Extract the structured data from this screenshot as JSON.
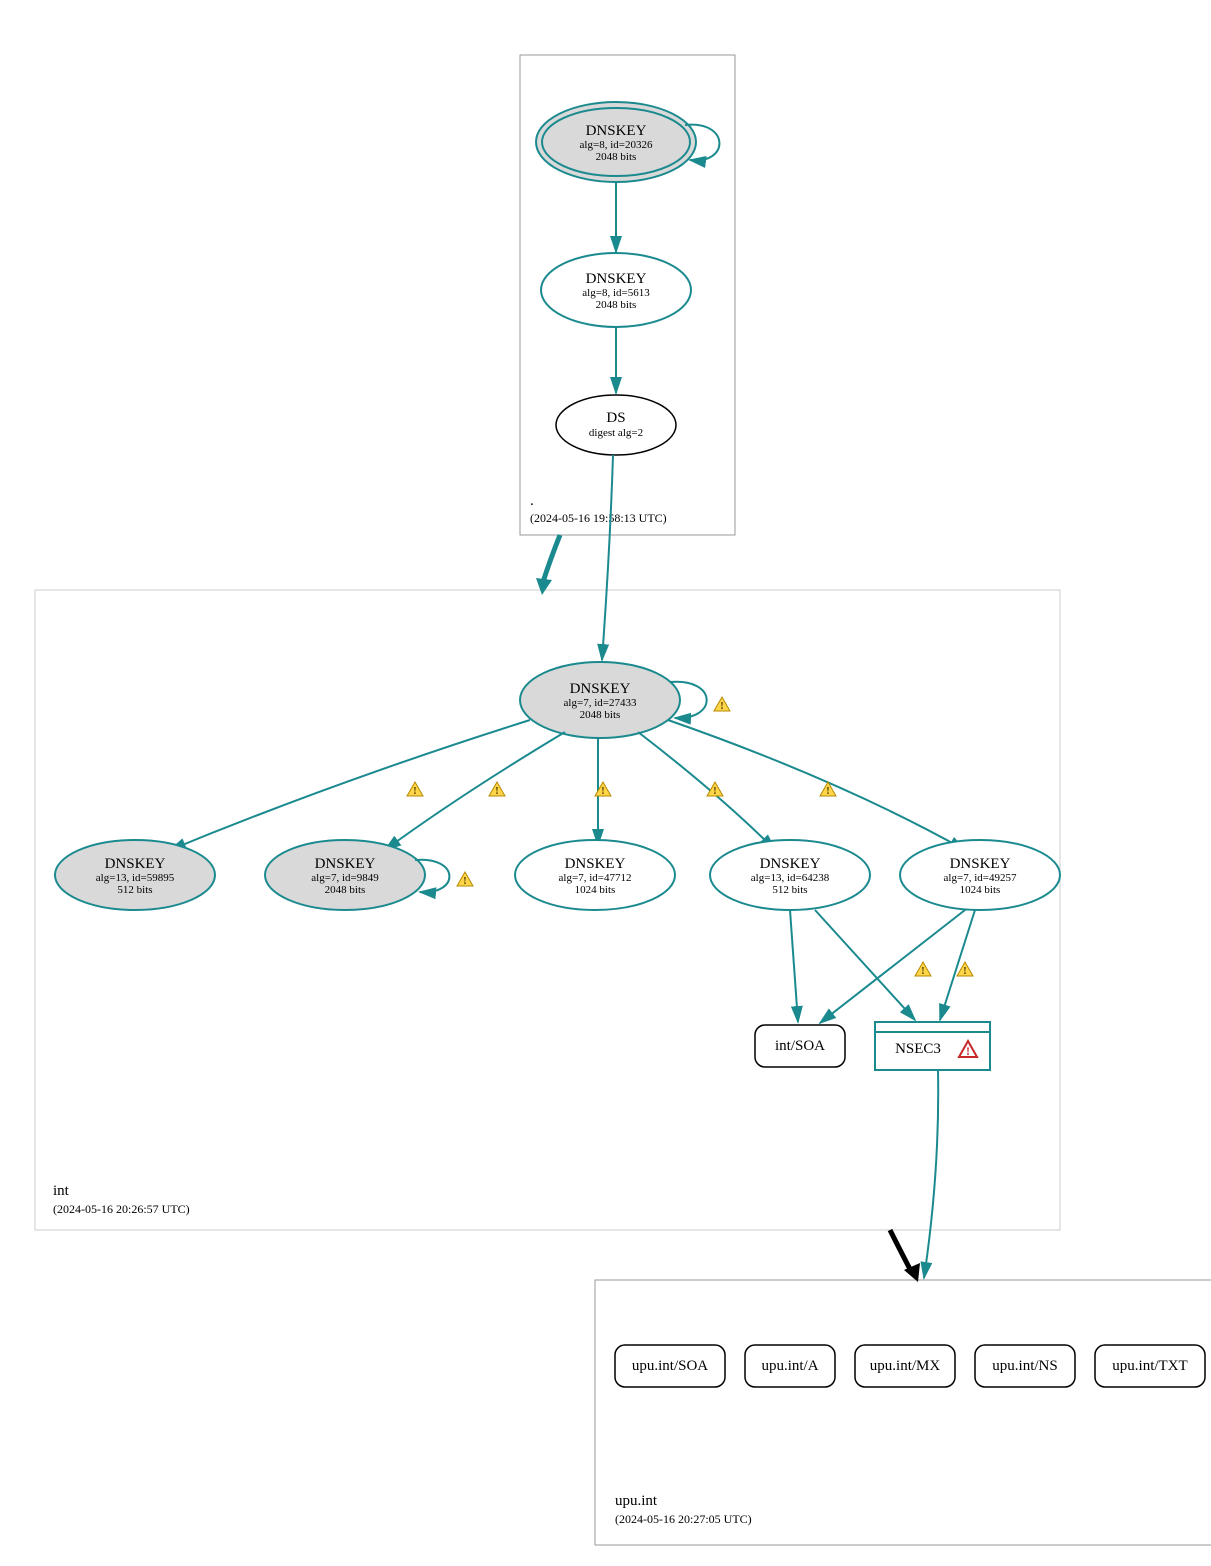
{
  "zones": {
    "root": {
      "label": ".",
      "timestamp": "(2024-05-16 19:58:13 UTC)"
    },
    "int": {
      "label": "int",
      "timestamp": "(2024-05-16 20:26:57 UTC)"
    },
    "upu": {
      "label": "upu.int",
      "timestamp": "(2024-05-16 20:27:05 UTC)"
    }
  },
  "nodes": {
    "root_ksk": {
      "title": "DNSKEY",
      "line2": "alg=8, id=20326",
      "line3": "2048 bits"
    },
    "root_zsk": {
      "title": "DNSKEY",
      "line2": "alg=8, id=5613",
      "line3": "2048 bits"
    },
    "root_ds": {
      "title": "DS",
      "line2": "digest alg=2"
    },
    "int_ksk": {
      "title": "DNSKEY",
      "line2": "alg=7, id=27433",
      "line3": "2048 bits"
    },
    "int_k1": {
      "title": "DNSKEY",
      "line2": "alg=13, id=59895",
      "line3": "512 bits"
    },
    "int_k2": {
      "title": "DNSKEY",
      "line2": "alg=7, id=9849",
      "line3": "2048 bits"
    },
    "int_k3": {
      "title": "DNSKEY",
      "line2": "alg=7, id=47712",
      "line3": "1024 bits"
    },
    "int_k4": {
      "title": "DNSKEY",
      "line2": "alg=13, id=64238",
      "line3": "512 bits"
    },
    "int_k5": {
      "title": "DNSKEY",
      "line2": "alg=7, id=49257",
      "line3": "1024 bits"
    },
    "int_soa": {
      "title": "int/SOA"
    },
    "int_nsec3": {
      "title": "NSEC3"
    },
    "upu_soa": {
      "title": "upu.int/SOA"
    },
    "upu_a": {
      "title": "upu.int/A"
    },
    "upu_mx": {
      "title": "upu.int/MX"
    },
    "upu_ns": {
      "title": "upu.int/NS"
    },
    "upu_txt": {
      "title": "upu.int/TXT"
    }
  }
}
